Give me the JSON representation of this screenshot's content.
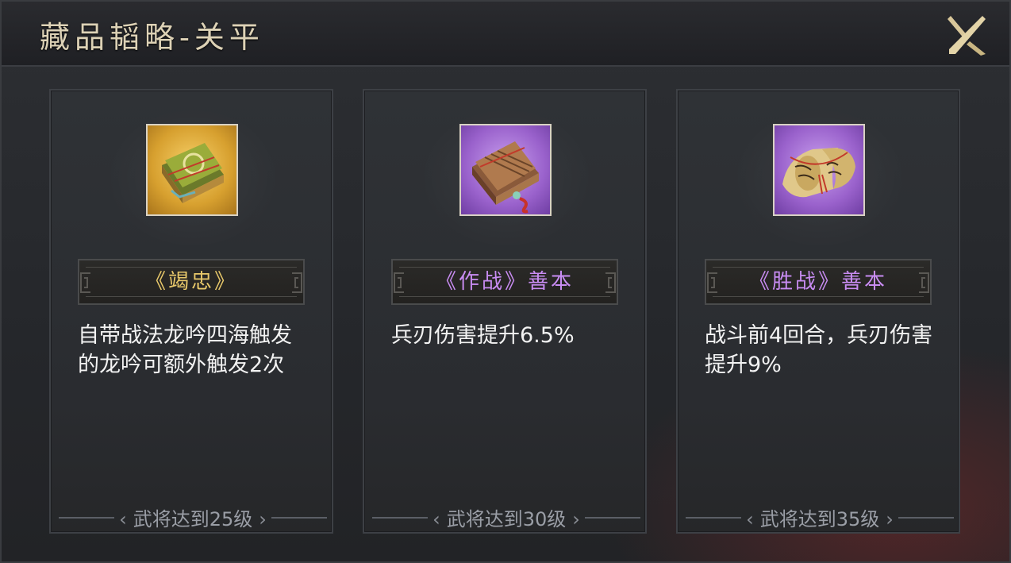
{
  "title": "藏品韬略-关平",
  "cards": [
    {
      "icon": "bamboo-book-gold-icon",
      "name_open": "《",
      "name_text": "竭忠",
      "name_close": "》",
      "name_suffix": "",
      "name_color": "#e8c86a",
      "description": "自带战法龙吟四海触发的龙吟可额外触发2次",
      "condition": "武将达到25级"
    },
    {
      "icon": "bamboo-book-purple-icon",
      "name_open": "《",
      "name_text": "作战",
      "name_close": "》",
      "name_suffix": "善本",
      "name_color": "#c88cf2",
      "description": "兵刃伤害提升6.5%",
      "condition": "武将达到30级"
    },
    {
      "icon": "scroll-purple-icon",
      "name_open": "《",
      "name_text": "胜战",
      "name_close": "》",
      "name_suffix": "善本",
      "name_color": "#c88cf2",
      "description": "战斗前4回合，兵刃伤害提升9%",
      "condition": "武将达到35级"
    }
  ]
}
